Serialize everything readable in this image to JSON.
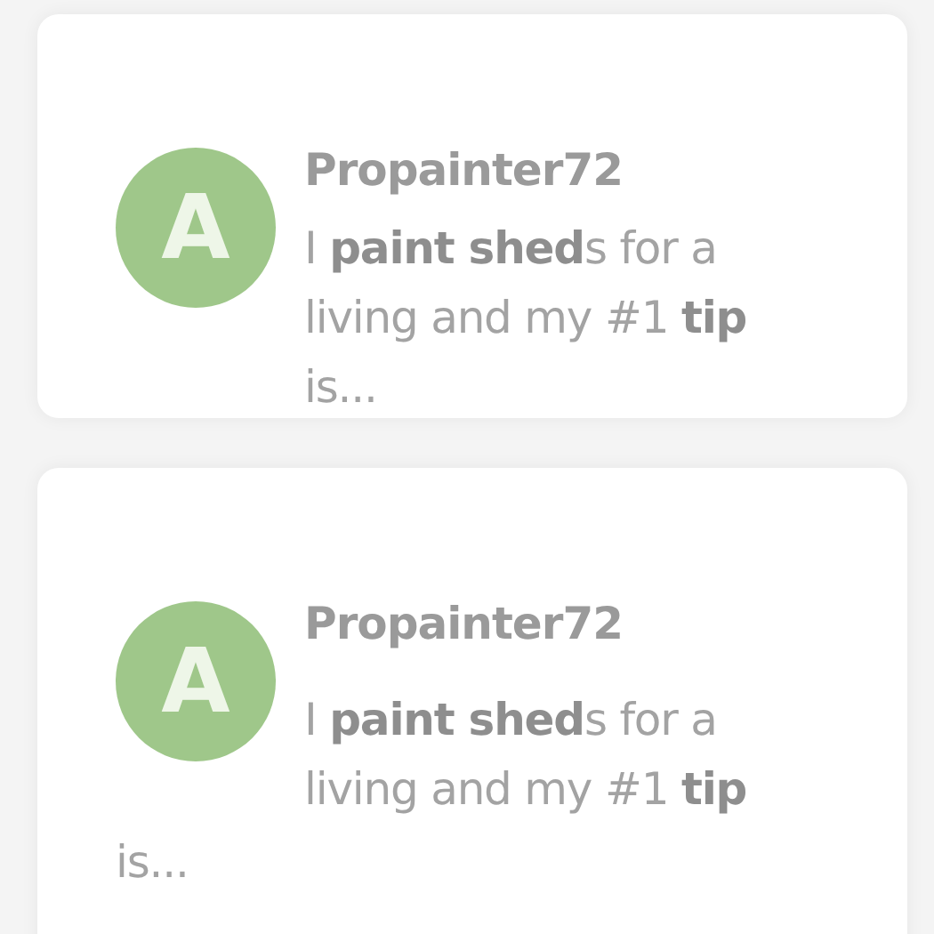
{
  "posts": [
    {
      "kind": "column",
      "avatar": "A",
      "username": "Propainter72",
      "lines": [
        "I **paint shed**s for a",
        "living and my #1 **tip**",
        "is..."
      ]
    },
    {
      "kind": "float",
      "avatar": "A",
      "username": "Propainter72",
      "lines": [
        "I **paint shed**s for a",
        "living and my #1 **tip**",
        "is..."
      ]
    }
  ]
}
